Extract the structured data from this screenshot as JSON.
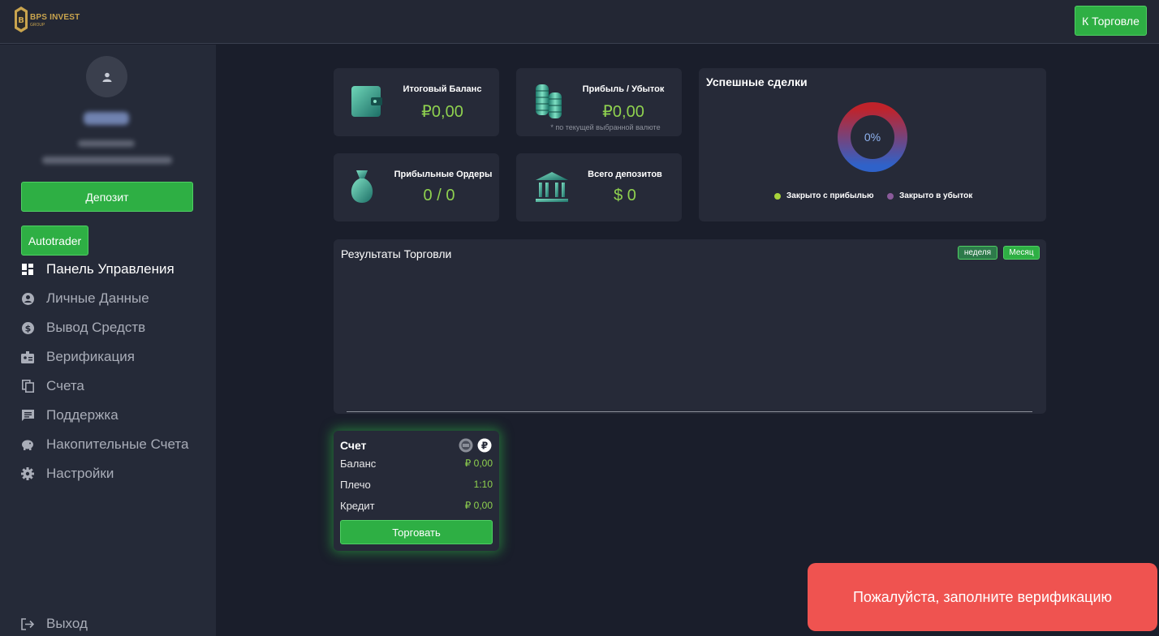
{
  "header": {
    "logo_text": "BPS INVEST",
    "logo_sub": "GROUP",
    "trade_button": "К Торговле"
  },
  "sidebar": {
    "deposit_button": "Депозит",
    "autotrader_button": "Autotrader",
    "items": [
      {
        "label": "Панель Управления",
        "icon": "dashboard-icon",
        "active": true
      },
      {
        "label": "Личные Данные",
        "icon": "user-circle-icon",
        "active": false
      },
      {
        "label": "Вывод Средств",
        "icon": "dollar-circle-icon",
        "active": false
      },
      {
        "label": "Верификация",
        "icon": "id-badge-icon",
        "active": false
      },
      {
        "label": "Счета",
        "icon": "copy-icon",
        "active": false
      },
      {
        "label": "Поддержка",
        "icon": "chat-icon",
        "active": false
      },
      {
        "label": "Накопительные Счета",
        "icon": "piggy-bank-icon",
        "active": false
      },
      {
        "label": "Настройки",
        "icon": "gear-icon",
        "active": false
      }
    ],
    "logout_label": "Выход"
  },
  "stats": {
    "balance": {
      "title": "Итоговый Баланс",
      "value": "₽0,00"
    },
    "profit": {
      "title": "Прибыль / Убыток",
      "value": "₽0,00",
      "note": "* по текущей выбранной валюте"
    },
    "orders": {
      "title": "Прибыльные Ордеры",
      "value": "0 / 0"
    },
    "deposits": {
      "title": "Всего депозитов",
      "value": "$ 0"
    }
  },
  "success": {
    "title": "Успешные сделки",
    "percent": "0%",
    "legend_profit": "Закрыто с прибылью",
    "legend_loss": "Закрыто в убыток"
  },
  "results": {
    "title": "Результаты Торговли",
    "week_label": "неделя",
    "month_label": "Месяц"
  },
  "account": {
    "title": "Счет",
    "balance_label": "Баланс",
    "balance_value": "₽ 0,00",
    "leverage_label": "Плечо",
    "leverage_value": "1:10",
    "credit_label": "Кредит",
    "credit_value": "₽ 0,00",
    "trade_button": "Торговать",
    "currency_symbol": "₽"
  },
  "toast": {
    "message": "Пожалуйста, заполните верификацию"
  },
  "colors": {
    "accent_green": "#2eaf44",
    "value_green": "#8fd14f",
    "toast_red": "#ef5350"
  }
}
